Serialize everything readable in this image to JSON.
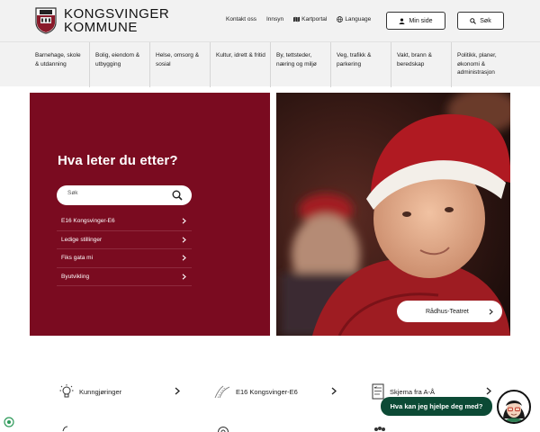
{
  "header": {
    "logo_line1": "KONGSVINGER",
    "logo_line2": "KOMMUNE",
    "links": {
      "kontakt": "Kontakt oss",
      "innsyn": "Innsyn",
      "kartportal": "Kartportal",
      "language": "Language"
    },
    "min_side": "Min side",
    "sok": "Søk"
  },
  "nav": {
    "items": [
      "Barnehage, skole & utdanning",
      "Bolig, eiendom & utbygging",
      "Helse, omsorg & sosial",
      "Kultur, idrett & fritid",
      "By, tettsteder, næring og miljø",
      "Veg, trafikk & parkering",
      "Vakt, brann & beredskap",
      "Politikk, planer, økonomi & administrasjon"
    ]
  },
  "search_panel": {
    "title": "Hva leter du etter?",
    "placeholder": "Søk",
    "quick_links": [
      "E16 Kongsvinger-E6",
      "Ledige stillinger",
      "Fiks gata mi",
      "Byutvikling"
    ]
  },
  "photo": {
    "button_label": "Rådhus-Teatret"
  },
  "bottom_links": {
    "kunngjoringer": "Kunngjøringer",
    "e16": "E16 Kongsvinger-E6",
    "skjema": "Skjema fra A-Å"
  },
  "chat": {
    "bubble": "Hva kan jeg hjelpe deg med?"
  },
  "colors": {
    "panel": "#7a0b20",
    "chat": "#0c4a35",
    "header_bg": "#f2f2f2"
  }
}
